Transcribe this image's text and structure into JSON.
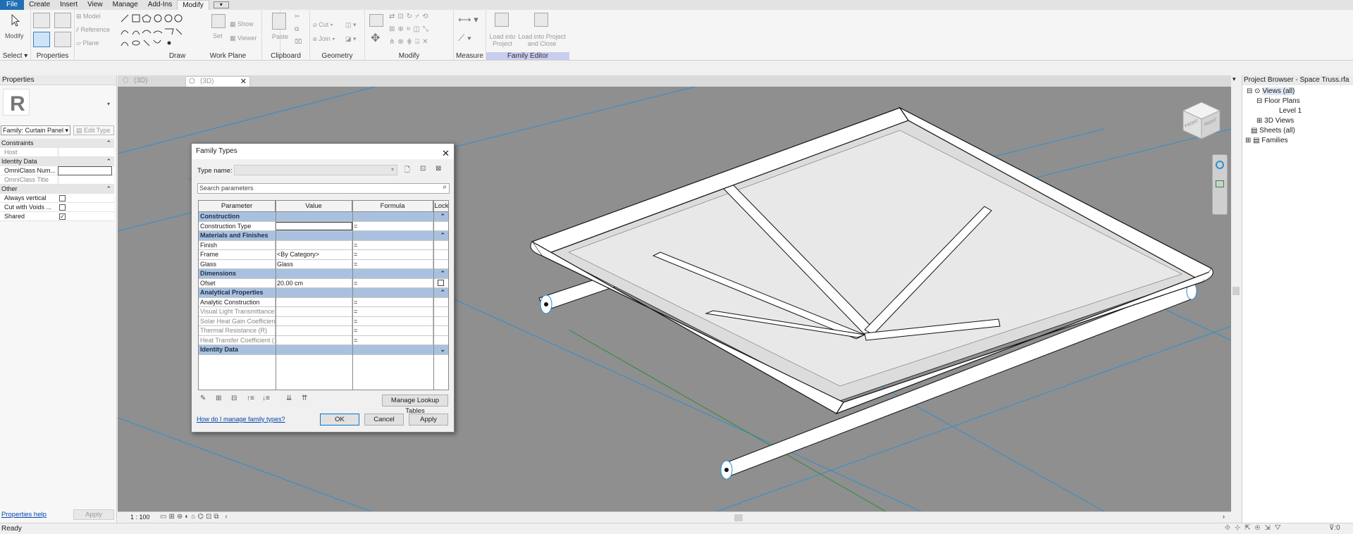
{
  "menu": {
    "items": [
      "File",
      "Create",
      "Insert",
      "View",
      "Manage",
      "Add-Ins",
      "Modify"
    ]
  },
  "ribbon": {
    "select_tools": [
      "Modify"
    ],
    "panels": [
      "Select",
      "Properties",
      "Draw",
      "Work Plane",
      "Clipboard",
      "Geometry",
      "Modify",
      "Measure",
      "Family Editor"
    ],
    "workplane_tools": [
      "Model",
      "Reference",
      "Plane",
      "Set",
      "Show",
      "Viewer"
    ],
    "clipboard_tools": [
      "Paste"
    ],
    "geometry_tools": [
      "Cut",
      "Join"
    ],
    "family_editor_tools": [
      "Load into Project",
      "Load into Project and Close"
    ]
  },
  "properties": {
    "title": "Properties",
    "family_selector": "Family: Curtain Panel",
    "edit_type": "Edit Type",
    "groups": {
      "constraints": "Constraints",
      "identity": "Identity Data",
      "other": "Other"
    },
    "rows": {
      "host": "Host",
      "omniclass_num": "OmniClass Num...",
      "omniclass_title": "OmniClass Title",
      "always_vertical": "Always vertical",
      "cut_with_voids": "Cut with Voids ...",
      "shared": "Shared"
    },
    "help_link": "Properties help",
    "apply": "Apply"
  },
  "view_tabs": [
    "(3D)",
    "(3D)"
  ],
  "view_controls": {
    "scale": "1 : 100"
  },
  "project_browser": {
    "title": "Project Browser - Space Truss.rfa",
    "nodes": [
      "Views (all)",
      "Floor Plans",
      "Level 1",
      "3D Views",
      "Sheets (all)",
      "Families"
    ]
  },
  "viewcube": {
    "left": "FRONT",
    "right": "RIGHT"
  },
  "dialog": {
    "title": "Family Types",
    "type_name_label": "Type name:",
    "search_placeholder": "Search parameters",
    "columns": [
      "Parameter",
      "Value",
      "Formula",
      "Lock"
    ],
    "groups": {
      "construction": "Construction",
      "materials": "Materials and Finishes",
      "dimensions": "Dimensions",
      "analytical": "Analytical Properties",
      "identity": "Identity Data"
    },
    "rows": {
      "construction_type": {
        "param": "Construction Type",
        "value": "",
        "formula": "="
      },
      "finish": {
        "param": "Finish",
        "value": "",
        "formula": "="
      },
      "frame": {
        "param": "Frame",
        "value": "<By Category>",
        "formula": "="
      },
      "glass": {
        "param": "Glass",
        "value": "Glass",
        "formula": "="
      },
      "ofset": {
        "param": "Ofset",
        "value": "20.00 cm",
        "formula": "="
      },
      "analytic_construction": {
        "param": "Analytic Construction",
        "value": "",
        "formula": "="
      },
      "visual_light": {
        "param": "Visual Light Transmittance",
        "value": "",
        "formula": "="
      },
      "solar_heat": {
        "param": "Solar Heat Gain Coefficien",
        "value": "",
        "formula": "="
      },
      "thermal": {
        "param": "Thermal Resistance (R)",
        "value": "",
        "formula": "="
      },
      "heat_transfer": {
        "param": "Heat Transfer Coefficient (",
        "value": "",
        "formula": "="
      }
    },
    "manage_lookup": "Manage Lookup Tables",
    "help_link": "How do I manage family types?",
    "ok": "OK",
    "cancel": "Cancel",
    "apply": "Apply"
  },
  "status": {
    "text": "Ready"
  },
  "colors": {
    "file_tab": "#1f6fb5",
    "family_editor": "#c9cdee",
    "group_header": "#a9c1df",
    "viewport_bg": "#8f8f8f",
    "ref_line": "#2d8fd0",
    "link": "#0645ad"
  }
}
